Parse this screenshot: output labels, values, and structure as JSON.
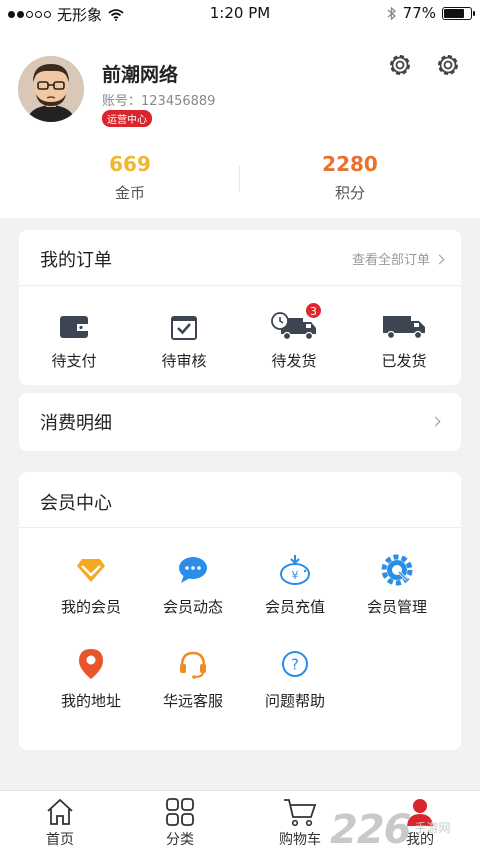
{
  "status_bar": {
    "carrier": "无形象",
    "time": "1:20 PM",
    "battery": "77%",
    "battery_level": 0.77
  },
  "profile": {
    "name": "前潮网络",
    "account_label": "账号：123456889",
    "badge": "运营中心",
    "coins": {
      "value": "669",
      "label": "金币"
    },
    "points": {
      "value": "2280",
      "label": "积分"
    }
  },
  "orders": {
    "title": "我的订单",
    "view_all": "查看全部订单",
    "items": [
      {
        "label": "待支付",
        "icon": "wallet-icon"
      },
      {
        "label": "待审核",
        "icon": "checklist-icon"
      },
      {
        "label": "待发货",
        "icon": "delivery-clock-icon",
        "badge": "3"
      },
      {
        "label": "已发货",
        "icon": "truck-icon"
      }
    ]
  },
  "consumption": {
    "title": "消费明细"
  },
  "member": {
    "title": "会员中心",
    "items": [
      {
        "label": "我的会员",
        "icon": "diamond-icon"
      },
      {
        "label": "会员动态",
        "icon": "chat-bubble-icon"
      },
      {
        "label": "会员充值",
        "icon": "piggy-bank-icon"
      },
      {
        "label": "会员管理",
        "icon": "gear-wrench-icon"
      },
      {
        "label": "我的地址",
        "icon": "location-pin-icon"
      },
      {
        "label": "华远客服",
        "icon": "headset-icon"
      },
      {
        "label": "问题帮助",
        "icon": "help-circle-icon"
      }
    ]
  },
  "tabbar": {
    "items": [
      {
        "label": "首页",
        "icon": "home-icon"
      },
      {
        "label": "分类",
        "icon": "grid-icon"
      },
      {
        "label": "购物车",
        "icon": "cart-icon"
      },
      {
        "label": "我的",
        "icon": "user-icon"
      }
    ]
  },
  "watermark": {
    "digits": "226",
    "text": "手游网"
  },
  "colors": {
    "brand_red": "#d8262c",
    "coins": "#f0b72f",
    "points": "#e8722b",
    "blue": "#2a8ee8",
    "orange": "#f08a24"
  }
}
